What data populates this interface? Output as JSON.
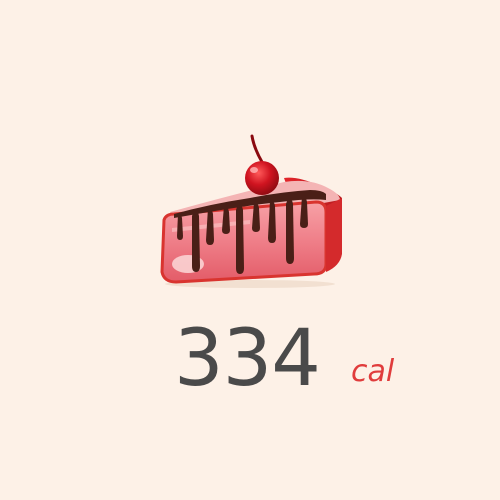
{
  "food": {
    "icon": "cheesecake-slice-icon",
    "colors": {
      "cake_body": "#f07b85",
      "cake_edge": "#d9342f",
      "chocolate": "#4a1f17",
      "cherry": "#c8101c"
    }
  },
  "calories": {
    "value": "334",
    "unit": "cal"
  },
  "theme": {
    "background": "#fdf1e7",
    "value_color": "#4a4a4a",
    "unit_color": "#e03c3c"
  }
}
